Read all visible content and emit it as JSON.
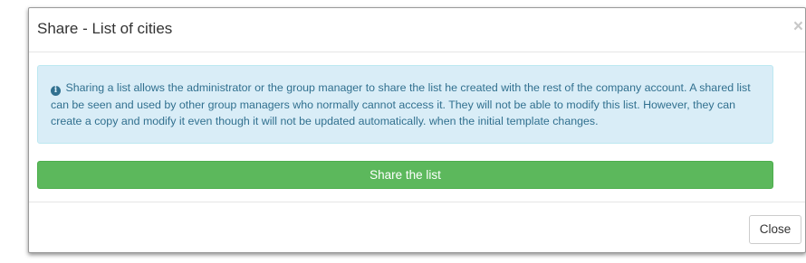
{
  "modal": {
    "title": "Share - List of cities",
    "close_symbol": "×",
    "close_icon": "close-icon"
  },
  "alert": {
    "icon": "info-circle-icon",
    "icon_glyph": "i",
    "text": "Sharing a list allows the administrator or the group manager to share the list he created with the rest of the company account. A shared list can be seen and used by other group managers who normally cannot access it. They will not be able to modify this list. However, they can create a copy and modify it even though it will not be updated automatically. when the initial template changes."
  },
  "actions": {
    "share_label": "Share the list",
    "close_label": "Close"
  },
  "colors": {
    "success": "#5cb85c",
    "info_background": "#d9edf7",
    "info_text": "#31708f"
  }
}
